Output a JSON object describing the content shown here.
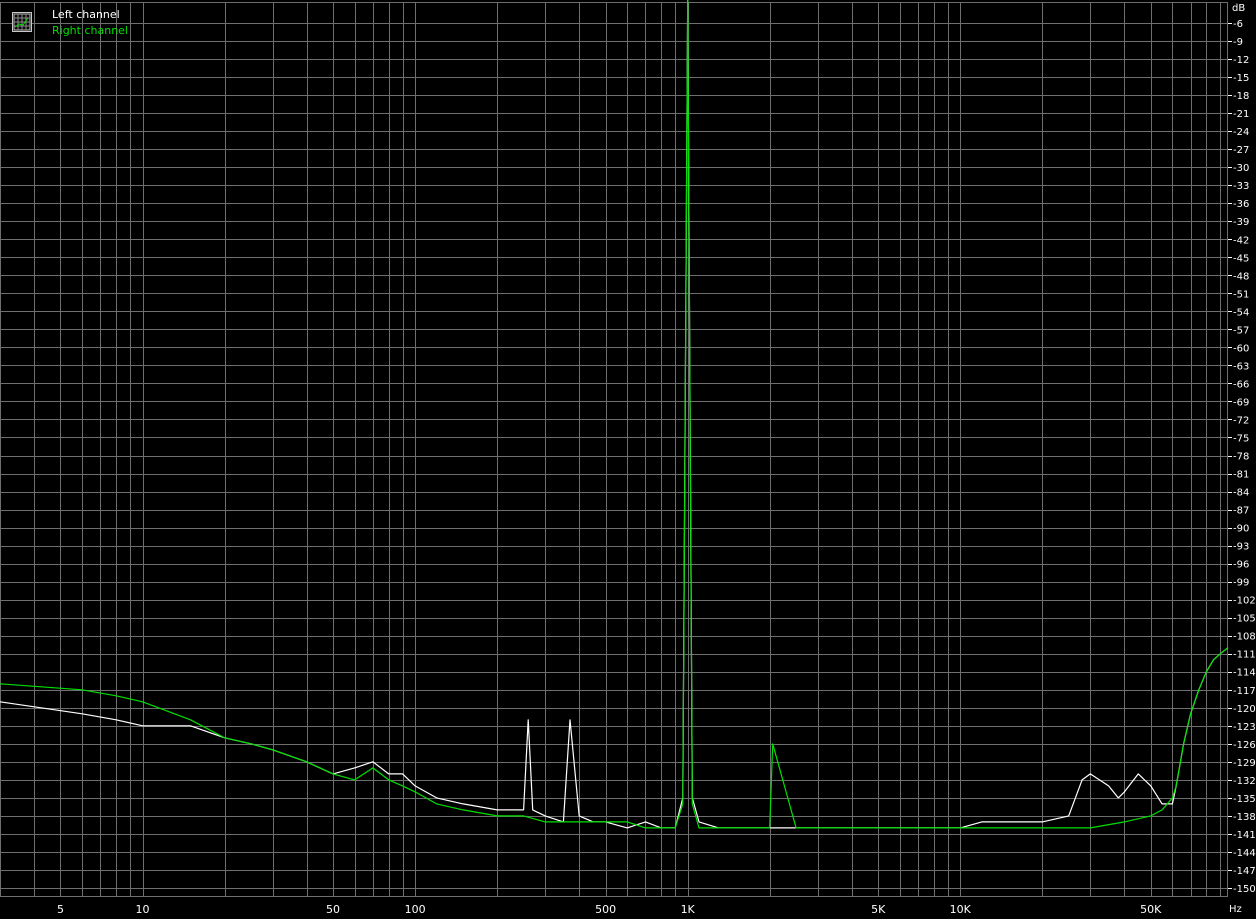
{
  "chart_data": {
    "type": "line",
    "title": "",
    "xlabel": "",
    "ylabel": "",
    "x_unit": "Hz",
    "y_unit": "dB",
    "x_scale": "log",
    "xlim": [
      3,
      96000
    ],
    "ylim": [
      -151.5,
      -2.5
    ],
    "grid": true,
    "legend_position": "top-left",
    "background_color": "#000000",
    "grid_color": "#6e6e6e",
    "x_ticks": [
      {
        "value": 5,
        "label": "5"
      },
      {
        "value": 10,
        "label": "10"
      },
      {
        "value": 50,
        "label": "50"
      },
      {
        "value": 100,
        "label": "100"
      },
      {
        "value": 500,
        "label": "500"
      },
      {
        "value": 1000,
        "label": "1K"
      },
      {
        "value": 5000,
        "label": "5K"
      },
      {
        "value": 10000,
        "label": "10K"
      },
      {
        "value": 50000,
        "label": "50K"
      }
    ],
    "y_ticks": [
      -6,
      -9,
      -12,
      -15,
      -18,
      -21,
      -24,
      -27,
      -30,
      -33,
      -36,
      -39,
      -42,
      -45,
      -48,
      -51,
      -54,
      -57,
      -60,
      -63,
      -66,
      -69,
      -72,
      -75,
      -78,
      -81,
      -84,
      -87,
      -90,
      -93,
      -96,
      -99,
      -102,
      -105,
      -108,
      -111,
      -114,
      -117,
      -120,
      -123,
      -126,
      -129,
      -132,
      -135,
      -138,
      -141,
      -144,
      -147,
      -150
    ],
    "series": [
      {
        "name": "Left channel",
        "color": "#ffffff",
        "x": [
          3,
          6,
          8,
          10,
          15,
          20,
          25,
          30,
          40,
          50,
          60,
          70,
          80,
          90,
          100,
          120,
          150,
          200,
          250,
          260,
          270,
          300,
          350,
          370,
          400,
          450,
          500,
          600,
          700,
          800,
          900,
          960,
          1000,
          1040,
          1100,
          1300,
          1500,
          1800,
          2000,
          2500,
          3000,
          4000,
          5000,
          6000,
          8000,
          10000,
          12000,
          15000,
          20000,
          25000,
          28000,
          30000,
          35000,
          38000,
          40000,
          45000,
          50000,
          55000,
          60000,
          62000,
          66000,
          70000,
          75000,
          80000,
          85000,
          90000,
          96000
        ],
        "y": [
          -119,
          -121,
          -122,
          -123,
          -123,
          -125,
          -126,
          -127,
          -129,
          -131,
          -130,
          -129,
          -131,
          -131,
          -133,
          -135,
          -136,
          -137,
          -137,
          -122,
          -137,
          -138,
          -139,
          -122,
          -138,
          -139,
          -139,
          -140,
          -139,
          -140,
          -140,
          -135,
          -2,
          -135,
          -139,
          -140,
          -140,
          -140,
          -140,
          -140,
          -140,
          -140,
          -140,
          -140,
          -140,
          -140,
          -139,
          -139,
          -139,
          -138,
          -132,
          -131,
          -133,
          -135,
          -134,
          -131,
          -133,
          -136,
          -136,
          -133,
          -126,
          -121,
          -117,
          -114,
          -112,
          -111,
          -110
        ]
      },
      {
        "name": "Right channel",
        "color": "#00e000",
        "x": [
          3,
          6,
          8,
          10,
          15,
          20,
          25,
          30,
          40,
          50,
          60,
          70,
          80,
          90,
          100,
          120,
          150,
          200,
          250,
          300,
          350,
          400,
          500,
          600,
          700,
          800,
          900,
          960,
          1000,
          1040,
          1100,
          1300,
          1500,
          1800,
          2000,
          2050,
          2500,
          3000,
          4000,
          5000,
          6000,
          8000,
          10000,
          15000,
          20000,
          30000,
          40000,
          50000,
          55000,
          60000,
          62000,
          66000,
          70000,
          75000,
          80000,
          85000,
          90000,
          96000
        ],
        "y": [
          -116,
          -117,
          -118,
          -119,
          -122,
          -125,
          -126,
          -127,
          -129,
          -131,
          -132,
          -130,
          -132,
          -133,
          -134,
          -136,
          -137,
          -138,
          -138,
          -139,
          -139,
          -139,
          -139,
          -139,
          -140,
          -140,
          -140,
          -136,
          -2,
          -136,
          -140,
          -140,
          -140,
          -140,
          -140,
          -126,
          -140,
          -140,
          -140,
          -140,
          -140,
          -140,
          -140,
          -140,
          -140,
          -140,
          -139,
          -138,
          -137,
          -135,
          -133,
          -126,
          -121,
          -117,
          -114,
          -112,
          -111,
          -110
        ]
      }
    ]
  }
}
